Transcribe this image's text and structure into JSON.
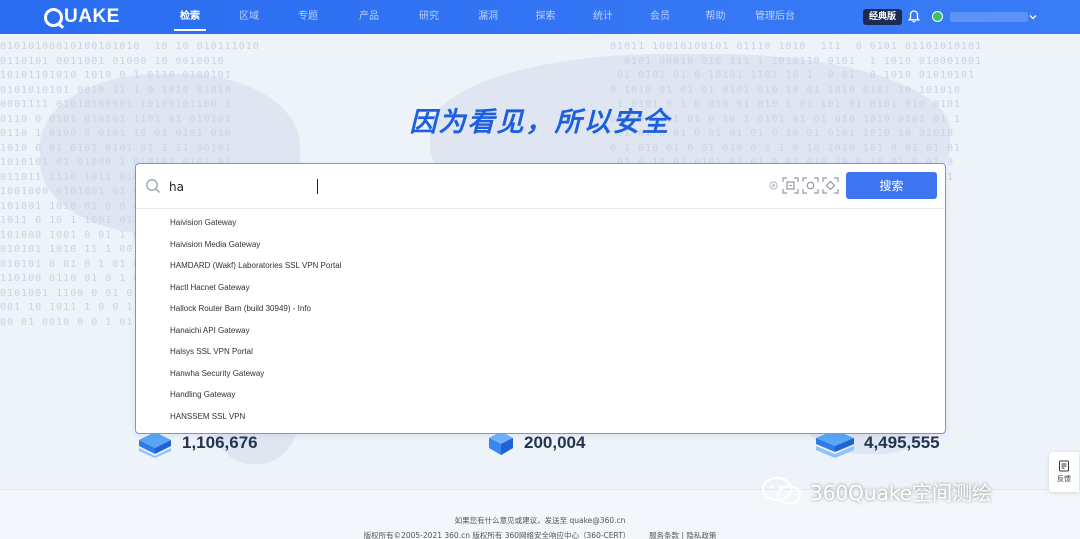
{
  "header": {
    "logo_text": "UAKE",
    "nav": [
      {
        "label": "检索",
        "active": true
      },
      {
        "label": "区域",
        "active": false
      },
      {
        "label": "专题",
        "active": false
      },
      {
        "label": "产品",
        "active": false
      },
      {
        "label": "研究",
        "active": false
      },
      {
        "label": "漏洞",
        "active": false
      },
      {
        "label": "探索",
        "active": false
      },
      {
        "label": "统计",
        "active": false
      },
      {
        "label": "会员",
        "active": false
      },
      {
        "label": "帮助",
        "active": false
      },
      {
        "label": "管理后台",
        "active": false
      }
    ],
    "classic_badge": "经典版",
    "icons": {
      "bell": "bell-icon",
      "user": "user-status-icon",
      "chevron": "chevron-down-icon"
    }
  },
  "hero": {
    "slogan": "因为看见，所以安全"
  },
  "search": {
    "value": "ha",
    "button_label": "搜索",
    "suggestions": [
      "Haivision Gateway",
      "Haivision Media Gateway",
      "HAMDARD (Wakf) Laboratories SSL VPN Portal",
      "Hactl Hacnet Gateway",
      "Hallock Router Barn (build 30949) - Info",
      "Hanaichi API Gateway",
      "Halsys SSL VPN Portal",
      "Hanwha Security Gateway",
      "Handling Gateway",
      "HANSSEM SSL VPN"
    ]
  },
  "stats": [
    {
      "value": "1,106,676"
    },
    {
      "value": "200,004"
    },
    {
      "value": "4,495,555"
    }
  ],
  "footer": {
    "line1": "如果您有什么意见或建议，发送至 quake@360.cn",
    "line2": "版权所有©2005-2021 360.cn 版权所有 360网络安全响应中心（360-CERT）",
    "terms": "服务条款",
    "privacy": "隐私政策"
  },
  "feedback_label": "反馈",
  "watermark_text": "360Quake空间测绘",
  "colors": {
    "primary": "#3d75f0",
    "nav_bg": "#2a6cf0",
    "slogan": "#1e5fe0",
    "classic_badge": "#1d2a52"
  }
}
